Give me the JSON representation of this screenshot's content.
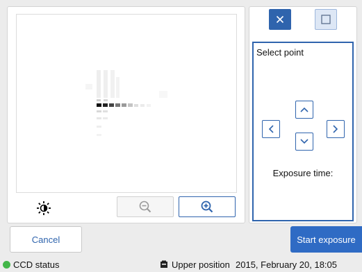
{
  "viewer": {
    "zoom_out_icon": "zoom-out-icon",
    "zoom_in_icon": "zoom-in-icon",
    "brightness_icon": "brightness-icon"
  },
  "tools": {
    "crosshair_icon": "close-x-icon",
    "square_icon": "square-icon",
    "select_point_label": "Select point",
    "exposure_time_label": "Exposure time:"
  },
  "actions": {
    "cancel_label": "Cancel",
    "start_label": "Start exposure"
  },
  "status": {
    "ccd_label": "CCD status",
    "ccd_color": "#43b649",
    "position_label": "Upper position",
    "datetime": "2015, February 20, 18:05"
  },
  "colors": {
    "accent": "#2f64ad",
    "start_button": "#2f6bc4"
  }
}
